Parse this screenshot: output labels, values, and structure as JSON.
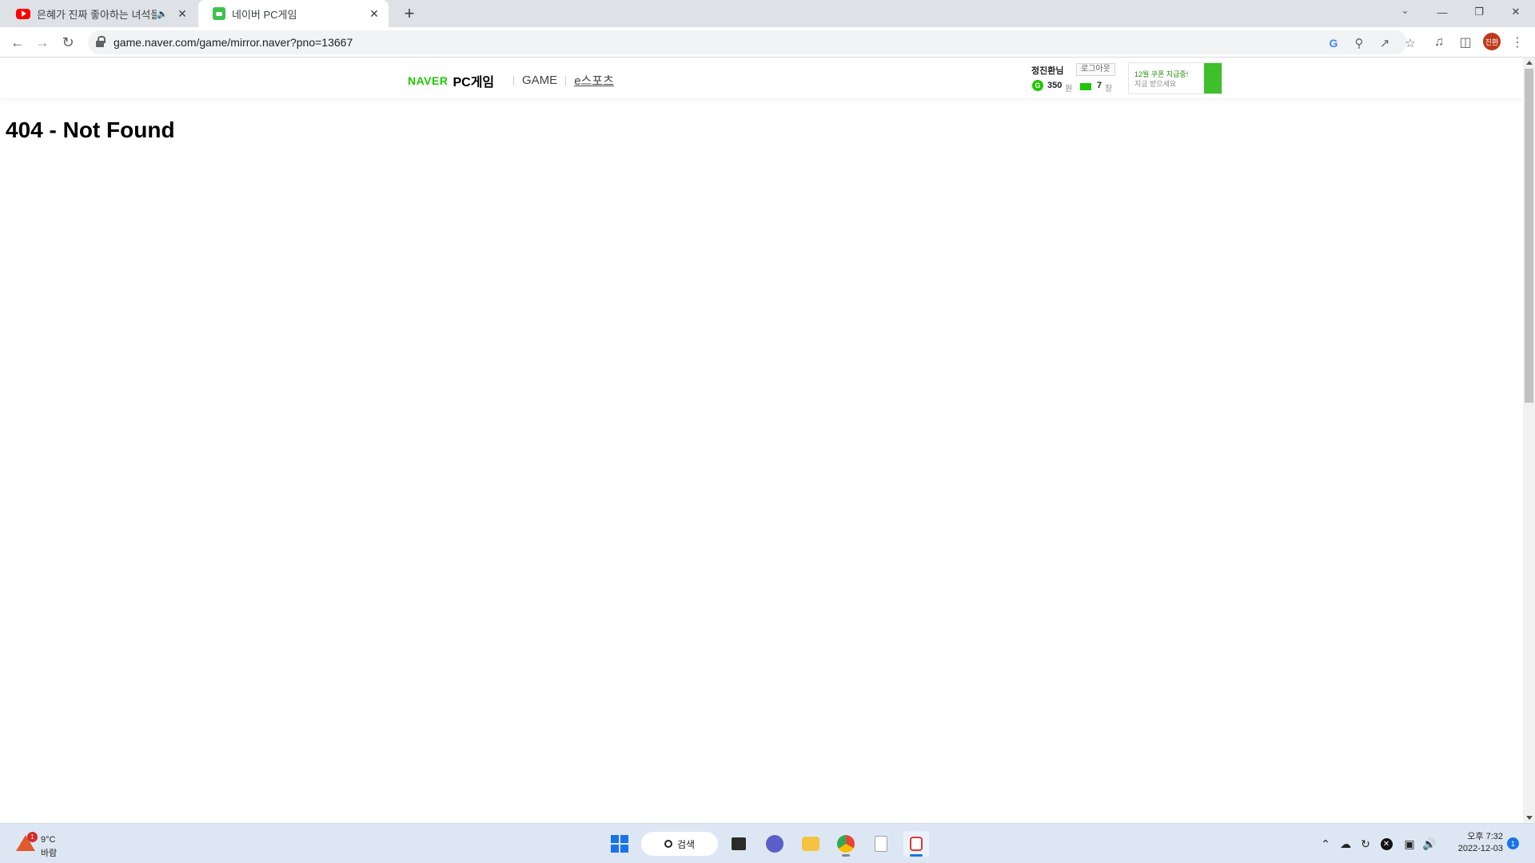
{
  "browser": {
    "tabs": [
      {
        "title": "은혜가 진짜 좋아하는 녀석들",
        "favicon": "youtube-icon",
        "muted": true,
        "active": false
      },
      {
        "title": "네이버 PC게임",
        "favicon": "naver-game-icon",
        "active": true
      }
    ],
    "new_tab_label": "+",
    "url": "game.naver.com/game/mirror.naver?pno=13667",
    "profile_label": "진환"
  },
  "site_header": {
    "logo_naver": "NAVER",
    "logo_pcgame": "PC게임",
    "nav": [
      "GAME",
      "e스포츠"
    ],
    "user": {
      "name": "정진환님",
      "logout_label": "로그아웃",
      "coins_value": "350",
      "coins_unit": "원",
      "tickets_value": "7",
      "tickets_unit": "장"
    },
    "promo": {
      "line1": "12월 쿠폰 지급중!",
      "line2": "지금 받으세요"
    }
  },
  "page": {
    "error_title": "404 - Not Found"
  },
  "taskbar": {
    "weather": {
      "badge": "1",
      "temp": "9°C",
      "desc": "바람"
    },
    "search_label": "검색",
    "clock": {
      "time": "오후 7:32",
      "date": "2022-12-03"
    },
    "notification_count": "1"
  },
  "colors": {
    "naver_green": "#1ec800",
    "tabstrip_bg": "#dee1e6",
    "taskbar_bg": "#dde7f3",
    "accent_blue": "#1a73e8"
  }
}
